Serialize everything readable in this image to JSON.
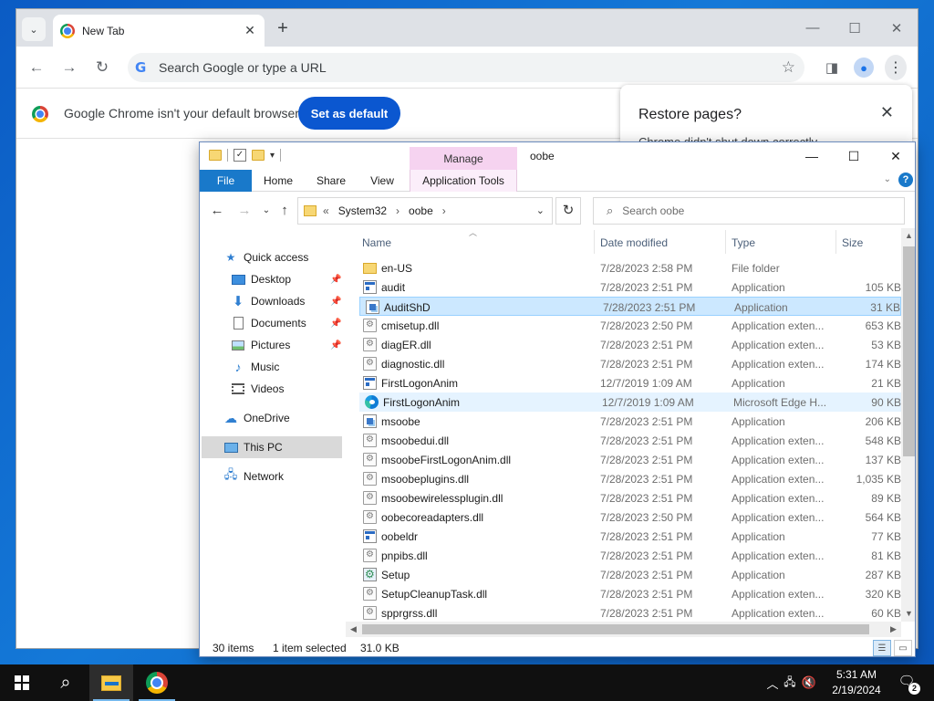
{
  "chrome": {
    "tab_title": "New Tab",
    "omnibox_placeholder": "Search Google or type a URL",
    "infobar_message": "Google Chrome isn't your default browser",
    "set_default_label": "Set as default",
    "restore_title": "Restore pages?",
    "restore_subtitle": "Chrome didn't shut down correctly"
  },
  "explorer": {
    "window_title": "oobe",
    "manage_label": "Manage",
    "ribbon_tabs": [
      "File",
      "Home",
      "Share",
      "View",
      "Application Tools"
    ],
    "address": {
      "prefix": "«",
      "crumbs": [
        "System32",
        "oobe"
      ]
    },
    "search_placeholder": "Search oobe",
    "nav": {
      "quick_access": "Quick access",
      "desktop": "Desktop",
      "downloads": "Downloads",
      "documents": "Documents",
      "pictures": "Pictures",
      "music": "Music",
      "videos": "Videos",
      "onedrive": "OneDrive",
      "this_pc": "This PC",
      "network": "Network"
    },
    "columns": {
      "name": "Name",
      "date": "Date modified",
      "type": "Type",
      "size": "Size"
    },
    "files": [
      {
        "icon": "folder",
        "name": "en-US",
        "date": "7/28/2023 2:58 PM",
        "type": "File folder",
        "size": ""
      },
      {
        "icon": "app",
        "name": "audit",
        "date": "7/28/2023 2:51 PM",
        "type": "Application",
        "size": "105 KB"
      },
      {
        "icon": "msoobe",
        "name": "AuditShD",
        "date": "7/28/2023 2:51 PM",
        "type": "Application",
        "size": "31 KB"
      },
      {
        "icon": "dll",
        "name": "cmisetup.dll",
        "date": "7/28/2023 2:50 PM",
        "type": "Application exten...",
        "size": "653 KB"
      },
      {
        "icon": "dll",
        "name": "diagER.dll",
        "date": "7/28/2023 2:51 PM",
        "type": "Application exten...",
        "size": "53 KB"
      },
      {
        "icon": "dll",
        "name": "diagnostic.dll",
        "date": "7/28/2023 2:51 PM",
        "type": "Application exten...",
        "size": "174 KB"
      },
      {
        "icon": "app",
        "name": "FirstLogonAnim",
        "date": "12/7/2019 1:09 AM",
        "type": "Application",
        "size": "21 KB"
      },
      {
        "icon": "edge",
        "name": "FirstLogonAnim",
        "date": "12/7/2019 1:09 AM",
        "type": "Microsoft Edge H...",
        "size": "90 KB"
      },
      {
        "icon": "msoobe",
        "name": "msoobe",
        "date": "7/28/2023 2:51 PM",
        "type": "Application",
        "size": "206 KB"
      },
      {
        "icon": "dll",
        "name": "msoobedui.dll",
        "date": "7/28/2023 2:51 PM",
        "type": "Application exten...",
        "size": "548 KB"
      },
      {
        "icon": "dll",
        "name": "msoobeFirstLogonAnim.dll",
        "date": "7/28/2023 2:51 PM",
        "type": "Application exten...",
        "size": "137 KB"
      },
      {
        "icon": "dll",
        "name": "msoobeplugins.dll",
        "date": "7/28/2023 2:51 PM",
        "type": "Application exten...",
        "size": "1,035 KB"
      },
      {
        "icon": "dll",
        "name": "msoobewirelessplugin.dll",
        "date": "7/28/2023 2:51 PM",
        "type": "Application exten...",
        "size": "89 KB"
      },
      {
        "icon": "dll",
        "name": "oobecoreadapters.dll",
        "date": "7/28/2023 2:50 PM",
        "type": "Application exten...",
        "size": "564 KB"
      },
      {
        "icon": "app",
        "name": "oobeldr",
        "date": "7/28/2023 2:51 PM",
        "type": "Application",
        "size": "77 KB"
      },
      {
        "icon": "dll",
        "name": "pnpibs.dll",
        "date": "7/28/2023 2:51 PM",
        "type": "Application exten...",
        "size": "81 KB"
      },
      {
        "icon": "setup",
        "name": "Setup",
        "date": "7/28/2023 2:51 PM",
        "type": "Application",
        "size": "287 KB"
      },
      {
        "icon": "dll",
        "name": "SetupCleanupTask.dll",
        "date": "7/28/2023 2:51 PM",
        "type": "Application exten...",
        "size": "320 KB"
      },
      {
        "icon": "dll",
        "name": "spprgrss.dll",
        "date": "7/28/2023 2:51 PM",
        "type": "Application exten...",
        "size": "60 KB"
      }
    ],
    "selected_index": 2,
    "hover_index": 7,
    "status": {
      "items": "30 items",
      "selected": "1 item selected",
      "size": "31.0 KB"
    }
  },
  "taskbar": {
    "time": "5:31 AM",
    "date": "2/19/2024",
    "notification_count": "2"
  }
}
